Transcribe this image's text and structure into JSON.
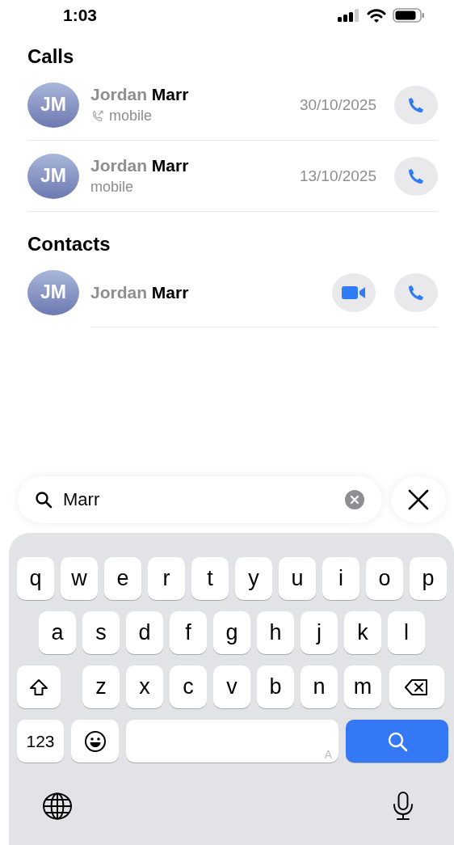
{
  "status_bar": {
    "time": "1:03"
  },
  "calls": {
    "title": "Calls",
    "rows": [
      {
        "initials": "JM",
        "name": "Jordan **Marr**",
        "direction_icon": true,
        "label": "mobile",
        "date": "30/10/2025"
      },
      {
        "initials": "JM",
        "name": "Jordan **Marr**",
        "direction_icon": false,
        "label": "mobile",
        "date": "13/10/2025"
      }
    ]
  },
  "contacts": {
    "title": "Contacts",
    "rows": [
      {
        "initials": "JM",
        "name": "Jordan **Marr**",
        "actions": [
          {
            "kind": "video"
          },
          {
            "kind": "phone"
          }
        ]
      }
    ]
  },
  "search": {
    "value": "Marr"
  },
  "keyboard": {
    "rows": [
      [
        {
          "kind": "letter",
          "label": "q"
        },
        {
          "kind": "letter",
          "label": "w"
        },
        {
          "kind": "letter",
          "label": "e"
        },
        {
          "kind": "letter",
          "label": "r"
        },
        {
          "kind": "letter",
          "label": "t"
        },
        {
          "kind": "letter",
          "label": "y"
        },
        {
          "kind": "letter",
          "label": "u"
        },
        {
          "kind": "letter",
          "label": "i"
        },
        {
          "kind": "letter",
          "label": "o"
        },
        {
          "kind": "letter",
          "label": "p"
        }
      ],
      [
        {
          "kind": "letter",
          "label": "a"
        },
        {
          "kind": "letter",
          "label": "s"
        },
        {
          "kind": "letter",
          "label": "d"
        },
        {
          "kind": "letter",
          "label": "f"
        },
        {
          "kind": "letter",
          "label": "g"
        },
        {
          "kind": "letter",
          "label": "h"
        },
        {
          "kind": "letter",
          "label": "j"
        },
        {
          "kind": "letter",
          "label": "k"
        },
        {
          "kind": "letter",
          "label": "l"
        }
      ],
      [
        {
          "kind": "shift"
        },
        {
          "kind": "letter",
          "label": "z"
        },
        {
          "kind": "letter",
          "label": "x"
        },
        {
          "kind": "letter",
          "label": "c"
        },
        {
          "kind": "letter",
          "label": "v"
        },
        {
          "kind": "letter",
          "label": "b"
        },
        {
          "kind": "letter",
          "label": "n"
        },
        {
          "kind": "letter",
          "label": "m"
        },
        {
          "kind": "delete"
        }
      ],
      [
        {
          "kind": "numbers",
          "label": "123"
        },
        {
          "kind": "emoji"
        },
        {
          "kind": "space",
          "label": "A"
        },
        {
          "kind": "search"
        }
      ]
    ]
  }
}
